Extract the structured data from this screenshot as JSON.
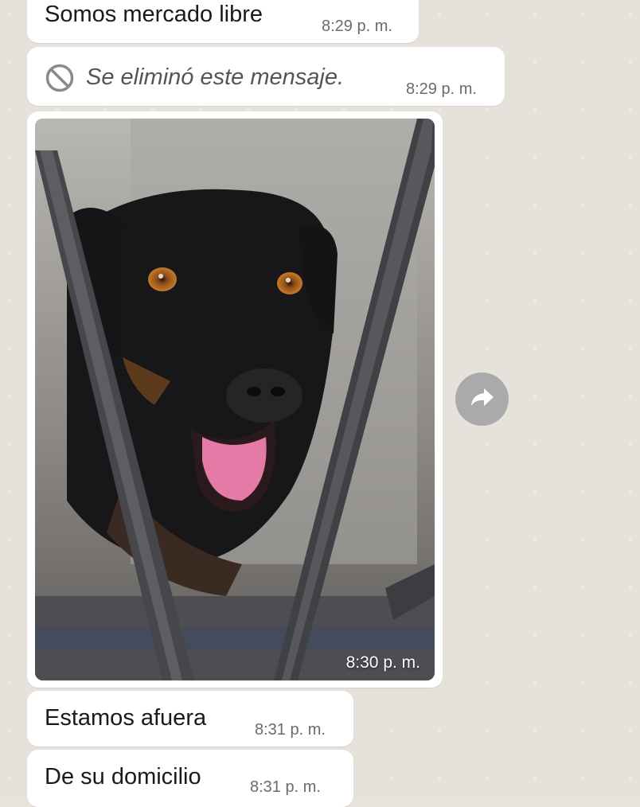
{
  "messages": [
    {
      "text": "Somos mercado libre",
      "time": "8:29 p. m."
    },
    {
      "text": "Se eliminó este mensaje.",
      "time": "8:29 p. m.",
      "deleted": true
    },
    {
      "image": "dog-photo",
      "time": "8:30 p. m."
    },
    {
      "text": "Estamos afuera",
      "time": "8:31 p. m."
    },
    {
      "text": "De su domicilio",
      "time": "8:31 p. m."
    }
  ],
  "icons": {
    "deleted": "prohibited-icon",
    "forward": "forward-arrow-icon"
  },
  "colors": {
    "chat_background": "#e6e2db",
    "bubble": "#ffffff",
    "forward_button": "#a9aaa9"
  }
}
